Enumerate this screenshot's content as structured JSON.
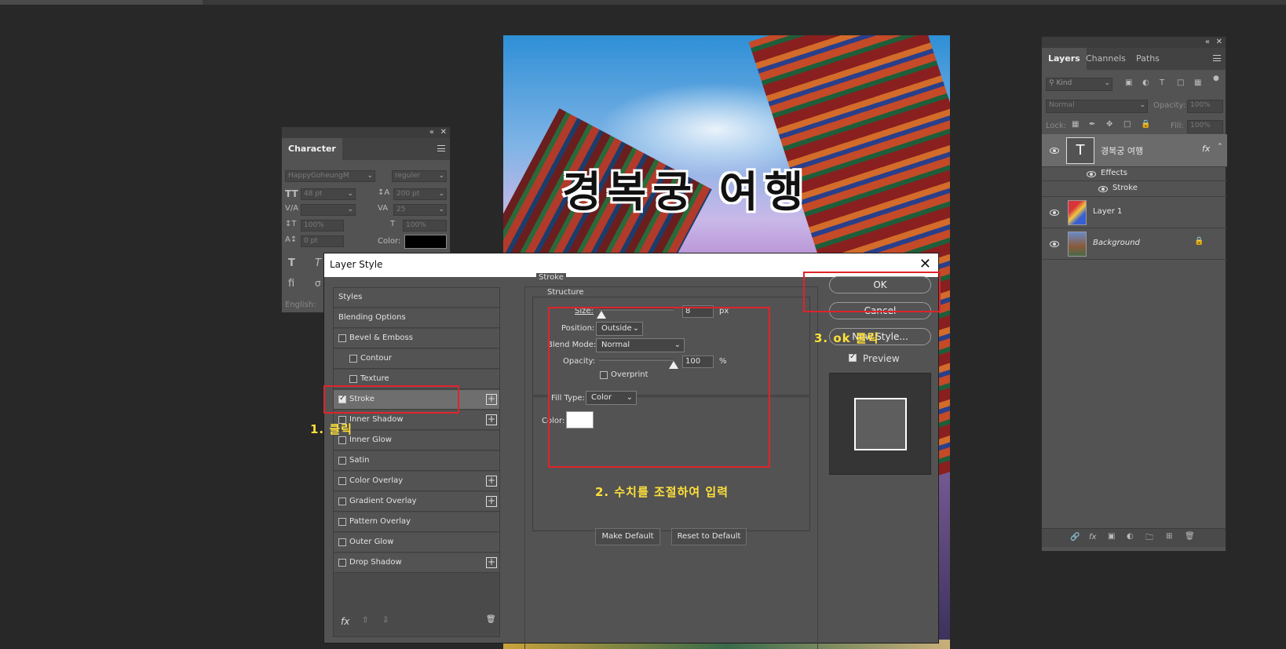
{
  "character_panel": {
    "tab": "Character",
    "font_family": "HappyGoheungM",
    "font_style": "reguler",
    "font_size": "48 pt",
    "leading": "200 pt",
    "kerning": "",
    "tracking": "25",
    "vertical_scale": "100%",
    "horizontal_scale": "100%",
    "baseline_shift": "0 pt",
    "color_label": "Color:",
    "color_value": "#000000",
    "language": "English:"
  },
  "canvas": {
    "title_text": "경복궁 여행"
  },
  "layer_style": {
    "title": "Layer Style",
    "styles": [
      {
        "label": "Styles",
        "checkbox": null,
        "plus": false
      },
      {
        "label": "Blending Options",
        "checkbox": null,
        "plus": false
      },
      {
        "label": "Bevel & Emboss",
        "checkbox": false,
        "plus": false
      },
      {
        "label": "Contour",
        "checkbox": false,
        "plus": false,
        "indent": true
      },
      {
        "label": "Texture",
        "checkbox": false,
        "plus": false,
        "indent": true
      },
      {
        "label": "Stroke",
        "checkbox": true,
        "plus": true,
        "selected": true
      },
      {
        "label": "Inner Shadow",
        "checkbox": false,
        "plus": true
      },
      {
        "label": "Inner Glow",
        "checkbox": false,
        "plus": false
      },
      {
        "label": "Satin",
        "checkbox": false,
        "plus": false
      },
      {
        "label": "Color Overlay",
        "checkbox": false,
        "plus": true
      },
      {
        "label": "Gradient Overlay",
        "checkbox": false,
        "plus": true
      },
      {
        "label": "Pattern Overlay",
        "checkbox": false,
        "plus": false
      },
      {
        "label": "Outer Glow",
        "checkbox": false,
        "plus": false
      },
      {
        "label": "Drop Shadow",
        "checkbox": false,
        "plus": true
      }
    ],
    "section_title": "Stroke",
    "structure_title": "Structure",
    "size_label": "Size:",
    "size_value": "8",
    "size_unit": "px",
    "size_slider_fraction": 0.03,
    "position_label": "Position:",
    "position_value": "Outside",
    "blend_mode_label": "Blend Mode:",
    "blend_mode_value": "Normal",
    "opacity_label": "Opacity:",
    "opacity_value": "100",
    "opacity_unit": "%",
    "opacity_slider_fraction": 1.0,
    "overprint_label": "Overprint",
    "fill_type_label": "Fill Type:",
    "fill_type_value": "Color",
    "color_label": "Color:",
    "stroke_color": "#ffffff",
    "make_default": "Make Default",
    "reset_to_default": "Reset to Default",
    "ok": "OK",
    "cancel": "Cancel",
    "new_style": "New Style...",
    "preview_label": "Preview",
    "preview_checked": true
  },
  "annotations": {
    "step1": "1. 클릭",
    "step2": "2. 수치를 조절하여 입력",
    "step3": "3. ok 클릭",
    "color": "#ffe03a",
    "box_color": "#e0232a"
  },
  "layers_panel": {
    "tabs": [
      "Layers",
      "Channels",
      "Paths"
    ],
    "filter_kind": "Kind",
    "blend_mode": "Normal",
    "opacity_label": "Opacity:",
    "opacity_value": "100%",
    "lock_label": "Lock:",
    "fill_label": "Fill:",
    "fill_value": "100%",
    "layers": [
      {
        "name": "경복궁 여행",
        "type": "text",
        "fx": "fx"
      },
      {
        "name": "Effects",
        "type": "effects"
      },
      {
        "name": "Stroke",
        "type": "effect"
      },
      {
        "name": "Layer 1",
        "type": "image"
      },
      {
        "name": "Background",
        "type": "background"
      }
    ]
  }
}
